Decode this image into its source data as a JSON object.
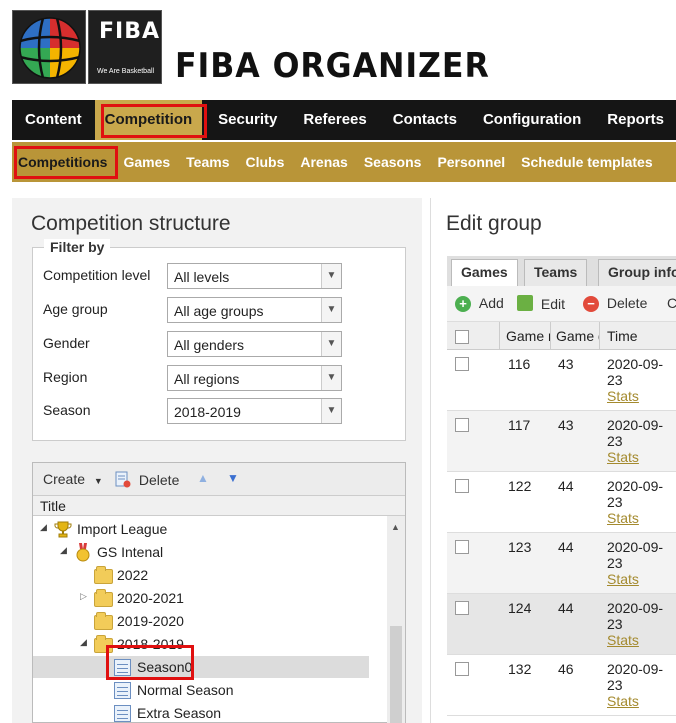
{
  "header": {
    "logo_text": "FIBA",
    "logo_tagline": "We Are Basketball",
    "app_title": "FIBA ORGANIZER"
  },
  "main_nav": [
    "Content",
    "Competition",
    "Security",
    "Referees",
    "Contacts",
    "Configuration",
    "Reports"
  ],
  "main_nav_active": "Competition",
  "sub_nav": [
    "Competitions",
    "Games",
    "Teams",
    "Clubs",
    "Arenas",
    "Seasons",
    "Personnel",
    "Schedule templates"
  ],
  "sub_nav_active": "Competitions",
  "competition_structure": {
    "title": "Competition structure",
    "filter": {
      "legend": "Filter by",
      "rows": [
        {
          "label": "Competition level",
          "value": "All levels"
        },
        {
          "label": "Age group",
          "value": "All age groups"
        },
        {
          "label": "Gender",
          "value": "All genders"
        },
        {
          "label": "Region",
          "value": "All regions"
        },
        {
          "label": "Season",
          "value": "2018-2019"
        }
      ]
    },
    "tree_toolbar": {
      "create": "Create",
      "delete": "Delete"
    },
    "tree_header": "Title",
    "tree": [
      {
        "label": "Import League",
        "icon": "trophy-icon",
        "expanded": true
      },
      {
        "label": "GS Intenal",
        "icon": "medal-icon",
        "expanded": true
      },
      {
        "label": "2022",
        "icon": "folder-icon"
      },
      {
        "label": "2020-2021",
        "icon": "folder-icon",
        "collapsed": true
      },
      {
        "label": "2019-2020",
        "icon": "folder-icon"
      },
      {
        "label": "2018-2019",
        "icon": "folder-icon",
        "expanded": true
      },
      {
        "label": "Season0",
        "icon": "sheet-icon",
        "selected": true
      },
      {
        "label": "Normal Season",
        "icon": "sheet-icon"
      },
      {
        "label": "Extra Season",
        "icon": "sheet-icon"
      }
    ]
  },
  "edit_group": {
    "title": "Edit group",
    "tabs": [
      "Games",
      "Teams",
      "Group info"
    ],
    "active_tab": "Games",
    "toolbar": {
      "add": "Add",
      "edit": "Edit",
      "delete": "Delete",
      "more": "Cl"
    },
    "columns": [
      "Game n",
      "Game d",
      "Time"
    ],
    "rows": [
      {
        "game_no": "116",
        "game_day": "43",
        "date": "2020-09-23",
        "stats": "Stats"
      },
      {
        "game_no": "117",
        "game_day": "43",
        "date": "2020-09-23",
        "stats": "Stats"
      },
      {
        "game_no": "122",
        "game_day": "44",
        "date": "2020-09-23",
        "stats": "Stats"
      },
      {
        "game_no": "123",
        "game_day": "44",
        "date": "2020-09-23",
        "stats": "Stats"
      },
      {
        "game_no": "124",
        "game_day": "44",
        "date": "2020-09-23",
        "stats": "Stats"
      },
      {
        "game_no": "132",
        "game_day": "46",
        "date": "2020-09-23",
        "stats": "Stats"
      }
    ]
  },
  "colors": {
    "nav_black": "#151515",
    "nav_gold": "#b99538",
    "active_gold": "#c9a84c",
    "highlight_red": "#e01010"
  }
}
